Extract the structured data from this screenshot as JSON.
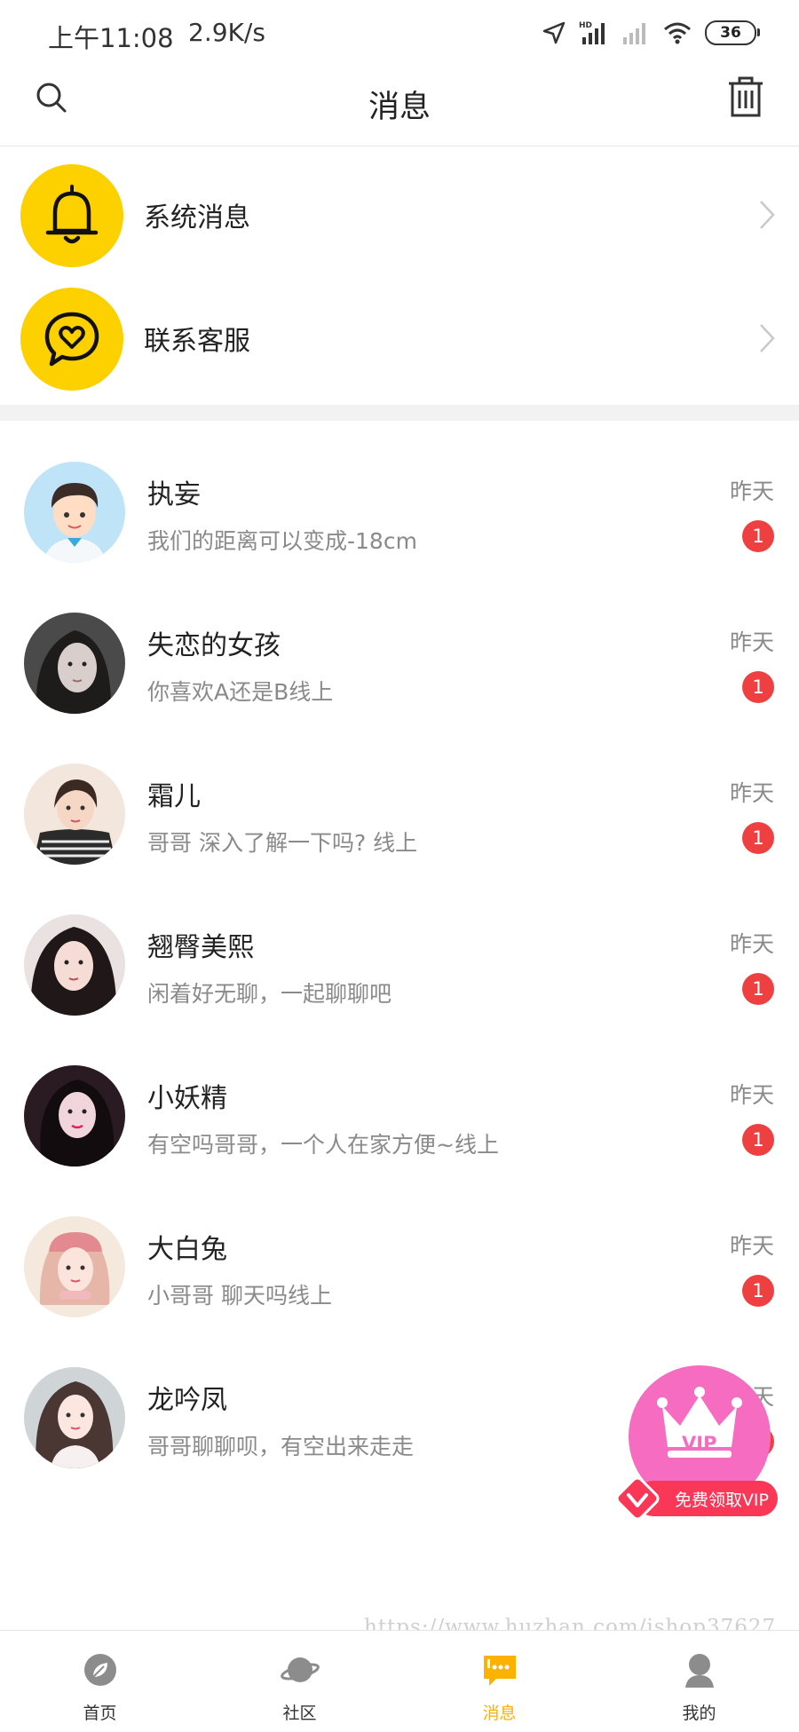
{
  "status_bar": {
    "time": "上午11:08",
    "speed": "2.9K/s",
    "battery": "36"
  },
  "header": {
    "title": "消息"
  },
  "menu": [
    {
      "label": "系统消息",
      "icon": "bell-icon"
    },
    {
      "label": "联系客服",
      "icon": "heart-chat-icon"
    }
  ],
  "conversations": [
    {
      "name": "执妄",
      "preview": "我们的距离可以变成-18cm",
      "time": "昨天",
      "unread": "1"
    },
    {
      "name": "失恋的女孩",
      "preview": "你喜欢A还是B线上",
      "time": "昨天",
      "unread": "1"
    },
    {
      "name": "霜儿",
      "preview": "哥哥 深入了解一下吗? 线上",
      "time": "昨天",
      "unread": "1"
    },
    {
      "name": "翘臀美熙",
      "preview": "闲着好无聊，一起聊聊吧",
      "time": "昨天",
      "unread": "1"
    },
    {
      "name": "小妖精",
      "preview": "有空吗哥哥，一个人在家方便~线上",
      "time": "昨天",
      "unread": "1"
    },
    {
      "name": "大白兔",
      "preview": "小哥哥 聊天吗线上",
      "time": "昨天",
      "unread": "1"
    },
    {
      "name": "龙吟凤",
      "preview": "哥哥聊聊呗，有空出来走走",
      "time": "昨天",
      "unread": "1"
    }
  ],
  "vip_promo": {
    "crown_text": "VIP",
    "label": "免费领取VIP"
  },
  "watermark": "https://www.huzhan.com/ishop37627",
  "tabs": [
    {
      "label": "首页",
      "icon": "leaf-icon"
    },
    {
      "label": "社区",
      "icon": "planet-icon"
    },
    {
      "label": "消息",
      "icon": "chat-icon",
      "active": true
    },
    {
      "label": "我的",
      "icon": "person-icon"
    }
  ],
  "colors": {
    "accent": "#fdd000",
    "badge": "#ee4041",
    "active_tab": "#fdb100",
    "vip_pink": "#f66cc0"
  }
}
